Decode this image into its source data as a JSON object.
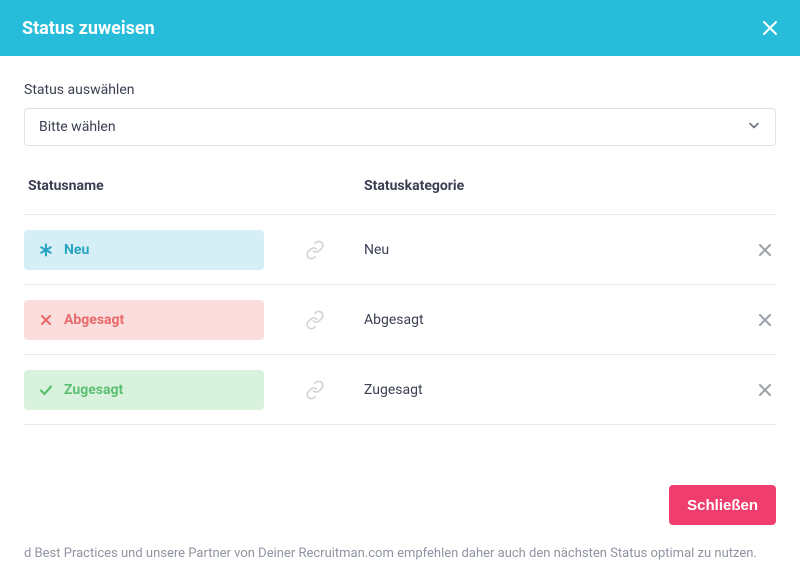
{
  "header": {
    "title": "Status zuweisen"
  },
  "select": {
    "label": "Status auswählen",
    "placeholder": "Bitte wählen"
  },
  "table": {
    "headers": {
      "name": "Statusname",
      "category": "Statuskategorie"
    },
    "rows": [
      {
        "name": "Neu",
        "category": "Neu"
      },
      {
        "name": "Abgesagt",
        "category": "Abgesagt"
      },
      {
        "name": "Zugesagt",
        "category": "Zugesagt"
      }
    ]
  },
  "footer": {
    "close": "Schließen"
  },
  "background_hint": "d Best Practices und unsere Partner von Deiner Recruitman.com empfehlen daher auch den nächsten Status optimal zu nutzen."
}
